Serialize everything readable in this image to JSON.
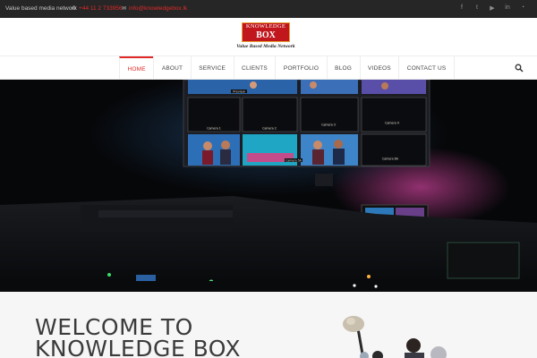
{
  "topbar": {
    "tagline": "Value based media network",
    "phone": "+44 11 2 733956",
    "email": "info@knowledgebox.lk",
    "socials": [
      {
        "icon": "facebook-icon",
        "glyph": "f"
      },
      {
        "icon": "twitter-icon",
        "glyph": "t"
      },
      {
        "icon": "youtube-icon",
        "glyph": "▶"
      },
      {
        "icon": "linkedin-icon",
        "glyph": "in"
      },
      {
        "icon": "rss-icon",
        "glyph": "◔"
      }
    ]
  },
  "logo": {
    "line1": "KNOWLEDGE",
    "line2": "BOX",
    "tagline": "Value Based Media Network"
  },
  "nav": {
    "items": [
      "HOME",
      "ABOUT",
      "SERVICE",
      "CLIENTS",
      "PORTFOLIO",
      "BLOG",
      "VIDEOS",
      "CONTACT US"
    ],
    "active_index": 0
  },
  "hero": {
    "monitor_labels": [
      "Preview",
      "Camera 1",
      "Camera 2",
      "Camera 3",
      "Camera 4",
      "Camera 5A",
      "Camera 6A"
    ]
  },
  "welcome": {
    "line1": "WELCOME TO",
    "line2": "KNOWLEDGE BOX"
  },
  "colors": {
    "accent": "#e02a2a",
    "topbar_bg": "#262626",
    "logo_red": "#c0161c"
  }
}
